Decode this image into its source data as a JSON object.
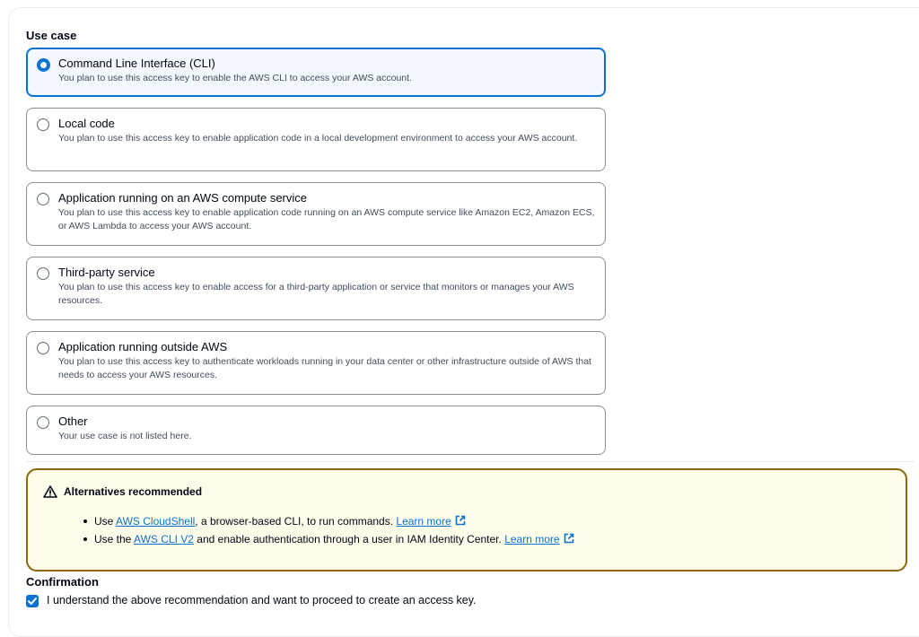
{
  "use_case": {
    "label": "Use case",
    "options": [
      {
        "title": "Command Line Interface (CLI)",
        "desc": "You plan to use this access key to enable the AWS CLI to access your AWS account.",
        "selected": true
      },
      {
        "title": "Local code",
        "desc": "You plan to use this access key to enable application code in a local development environment to access your AWS account.",
        "selected": false
      },
      {
        "title": "Application running on an AWS compute service",
        "desc": "You plan to use this access key to enable application code running on an AWS compute service like Amazon EC2, Amazon ECS, or AWS Lambda to access your AWS account.",
        "selected": false
      },
      {
        "title": "Third-party service",
        "desc": "You plan to use this access key to enable access for a third-party application or service that monitors or manages your AWS resources.",
        "selected": false
      },
      {
        "title": "Application running outside AWS",
        "desc": "You plan to use this access key to authenticate workloads running in your data center or other infrastructure outside of AWS that needs to access your AWS resources.",
        "selected": false
      },
      {
        "title": "Other",
        "desc": "Your use case is not listed here.",
        "selected": false
      }
    ]
  },
  "alert": {
    "title": "Alternatives recommended",
    "item1": {
      "prefix": "Use ",
      "link": "AWS CloudShell",
      "middle": ", a browser-based CLI, to run commands. ",
      "learn_more": "Learn more"
    },
    "item2": {
      "prefix": "Use the ",
      "link": "AWS CLI V2",
      "middle": " and enable authentication through a user in IAM Identity Center. ",
      "learn_more": "Learn more"
    }
  },
  "confirmation": {
    "label": "Confirmation",
    "checkbox_text": "I understand the above recommendation and want to proceed to create an access key.",
    "checked": true
  },
  "colors": {
    "accent": "#0972d3",
    "warning_border": "#8d6605",
    "warning_bg": "#fffce9"
  }
}
